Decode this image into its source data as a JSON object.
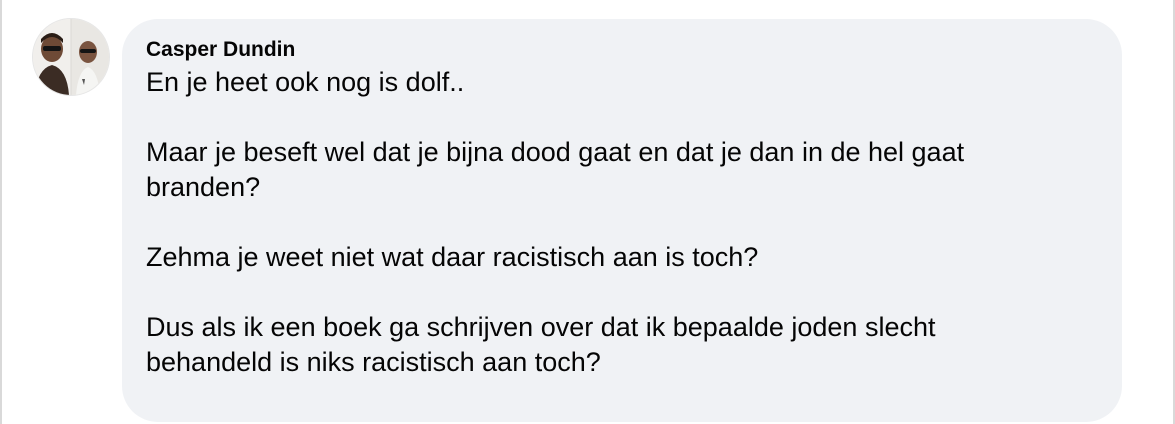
{
  "comment": {
    "author": "Casper Dundin",
    "avatar_icon": "profile-photo-icon",
    "paragraphs": [
      {
        "lines": [
          "En je heet ook nog is dolf.."
        ]
      },
      {
        "lines": [
          "Maar je beseft wel dat je bijna dood gaat en dat je dan in de hel gaat",
          "branden?"
        ]
      },
      {
        "lines": [
          "Zehma je weet niet wat daar racistisch aan is toch?"
        ]
      },
      {
        "lines": [
          "Dus als ik een boek ga schrijven over dat ik bepaalde joden slecht",
          "behandeld is niks racistisch aan toch?"
        ]
      }
    ]
  },
  "colors": {
    "bubble_background": "#f0f2f5",
    "text": "#050505",
    "page_background": "#ffffff"
  }
}
